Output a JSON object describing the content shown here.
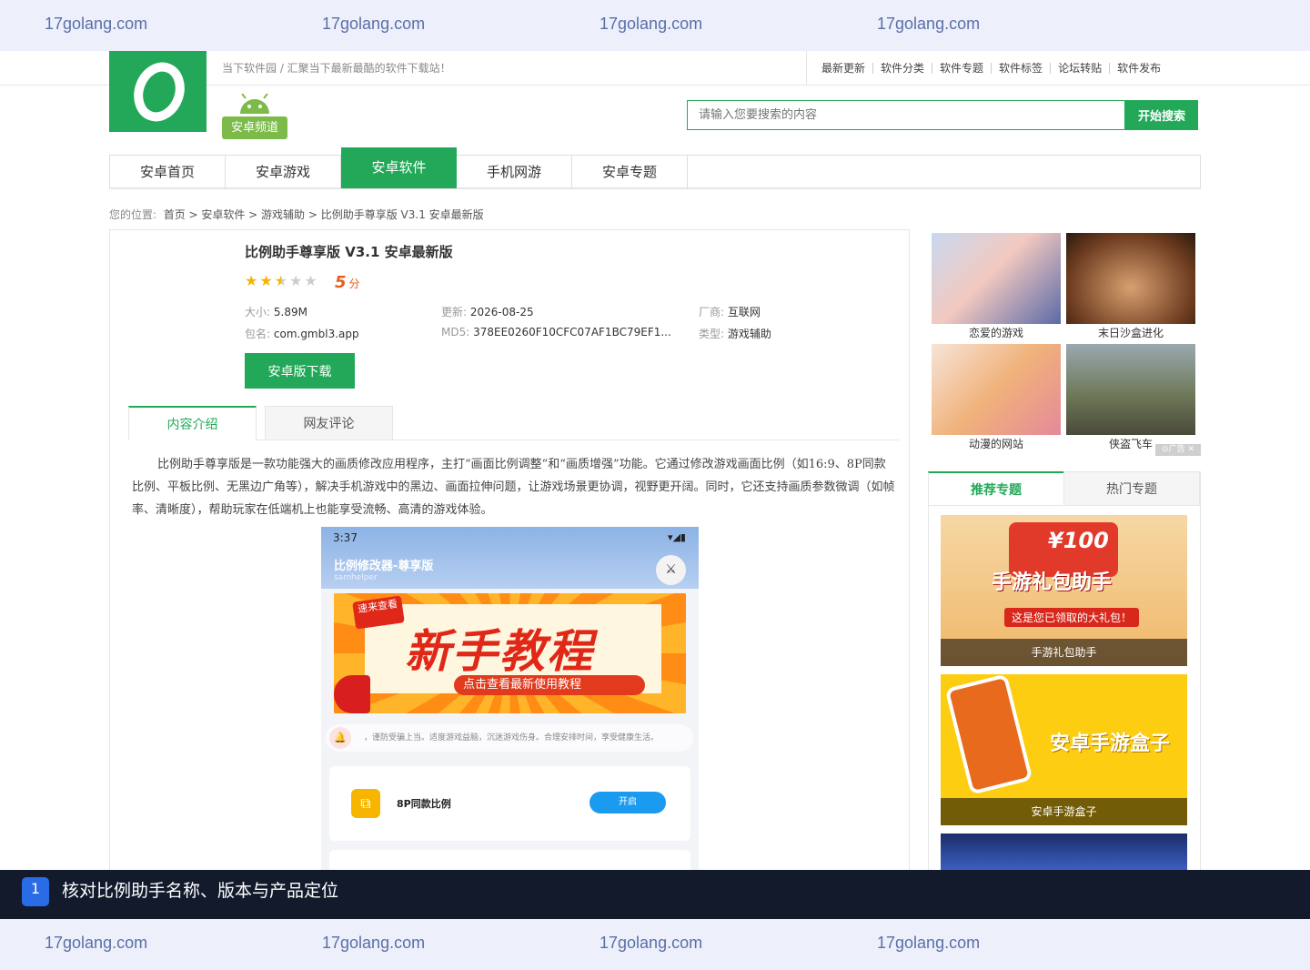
{
  "watermark": {
    "text": "17golang.com"
  },
  "header": {
    "slogan": "当下软件园 / 汇聚当下最新最酷的软件下载站！",
    "links": [
      "最新更新",
      "软件分类",
      "软件专题",
      "软件标签",
      "论坛转贴",
      "软件发布"
    ],
    "channel": "安卓频道",
    "search_placeholder": "请输入您要搜索的内容",
    "search_button": "开始搜索"
  },
  "nav": {
    "tabs": [
      "安卓首页",
      "安卓游戏",
      "安卓软件",
      "手机网游",
      "安卓专题"
    ],
    "active": "安卓软件"
  },
  "breadcrumb": {
    "prefix": "您的位置:",
    "path": "首页 > 安卓软件 > 游戏辅助 > 比例助手尊享版 V3.1 安卓最新版"
  },
  "app": {
    "title": "比例助手尊享版 V3.1 安卓最新版",
    "rating": 2.5,
    "score": "5",
    "score_unit": "分",
    "size_label": "大小:",
    "size": "5.89M",
    "update_label": "更新:",
    "update": "2026-08-25",
    "vendor_label": "厂商:",
    "vendor": "互联网",
    "package_label": "包名:",
    "package": "com.gmbl3.app",
    "md5_label": "MD5:",
    "md5": "378EE0260F10CFC07AF1BC79EF1...",
    "type_label": "类型:",
    "type": "游戏辅助",
    "download": "安卓版下载"
  },
  "content_tabs": [
    "内容介绍",
    "网友评论"
  ],
  "description": "比例助手尊享版是一款功能强大的画质修改应用程序，主打“画面比例调整”和“画质增强”功能。它通过修改游戏画面比例（如16:9、8P同款比例、平板比例、无黑边广角等），解决手机游戏中的黑边、画面拉伸问题，让游戏场景更协调，视野更开阔。同时，它还支持画质参数微调（如帧率、清晰度），帮助玩家在低端机上也能享受流畅、高清的游戏体验。",
  "screenshot": {
    "time": "3:37",
    "app_title": "比例修改器-尊享版",
    "app_sub": "samhelper",
    "badge": "速来查看",
    "banner": "新手教程",
    "cta": "点击查看最新使用教程",
    "notice": "，谨防受骗上当。适度游戏益脑，沉迷游戏伤身。合理安排时间，享受健康生活。",
    "item_label": "8P同款比例",
    "item_toggle": "开启"
  },
  "sidebar": {
    "thumbs": [
      "恋爱的游戏",
      "末日沙盒进化",
      "动漫的网站",
      "侠盗飞车"
    ],
    "ad": "广告",
    "tabs": [
      "推荐专题",
      "热门专题"
    ],
    "topics": [
      {
        "caption": "手游礼包助手",
        "art": "手游礼包助手",
        "price": "¥100",
        "note": "这是您已领取的大礼包！"
      },
      {
        "caption": "安卓手游盒子",
        "art": "安卓手游盒子"
      }
    ]
  },
  "caption": {
    "num": "1",
    "text": "核对比例助手名称、版本与产品定位"
  },
  "colors": {
    "brand": "#22a858",
    "accent": "#e85d1c"
  }
}
